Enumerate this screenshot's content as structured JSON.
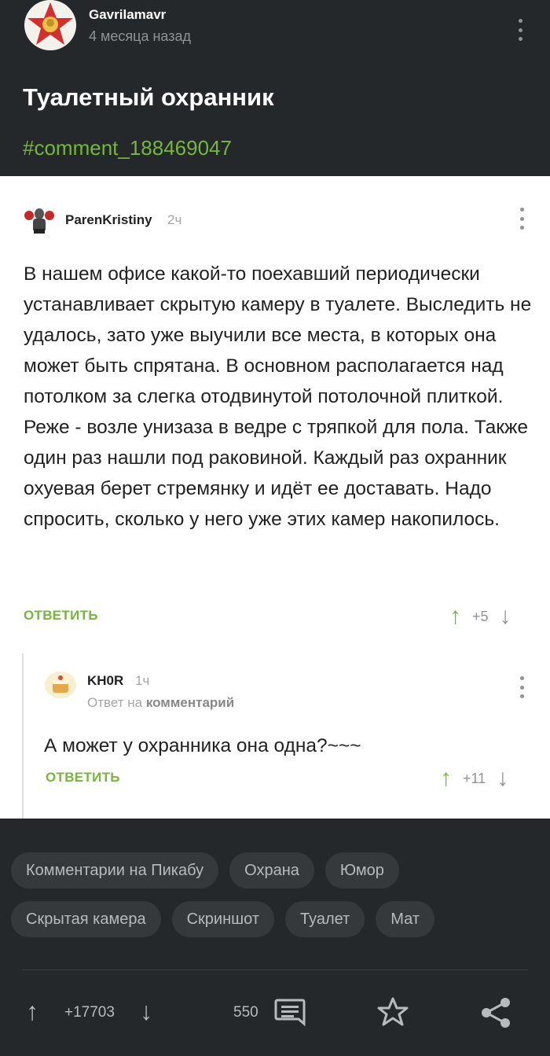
{
  "post": {
    "author": "Gavrilamavr",
    "time": "4 месяца назад",
    "title": "Туалетный охранник",
    "link": "#comment_188469047"
  },
  "comments": [
    {
      "author": "ParenKristiny",
      "time": "2ч",
      "body": "В нашем офисе какой-то поехавший периодически устанавливает скрытую камеру в туалете. Выследить не удалось, зато уже выучили все места, в которых она может быть спрятана. В основном располагается над потолком за слегка отодвинутой потолочной плиткой. Реже - возле унизаза в ведре с тряпкой для пола. Также один раз нашли под раковиной. Каждый раз охранник охуевая берет стремянку и идёт ее доставать. Надо спросить, сколько у него уже этих камер накопилось.",
      "reply_label": "ОТВЕТИТЬ",
      "rating": "+5"
    },
    {
      "author": "KH0R",
      "time": "1ч",
      "reply_to_prefix": "Ответ на",
      "reply_to_target": "комментарий",
      "body": "А может у охранника она одна?~~~",
      "reply_label": "ОТВЕТИТЬ",
      "rating": "+11"
    }
  ],
  "tags": [
    [
      "Комментарии на Пикабу",
      "Охрана",
      "Юмор"
    ],
    [
      "Скрытая камера",
      "Скриншот",
      "Туалет",
      "Мат"
    ]
  ],
  "footer": {
    "rating": "+17703",
    "comments_count": "550"
  },
  "colors": {
    "accent_green": "#75b73b",
    "background_dark": "#24282b",
    "tag_background": "#35393c"
  },
  "icons": {
    "upvote": "arrow-up-icon",
    "downvote": "arrow-down-icon",
    "menu": "kebab-menu-icon",
    "comments": "comments-icon",
    "save": "star-icon",
    "share": "share-icon"
  }
}
